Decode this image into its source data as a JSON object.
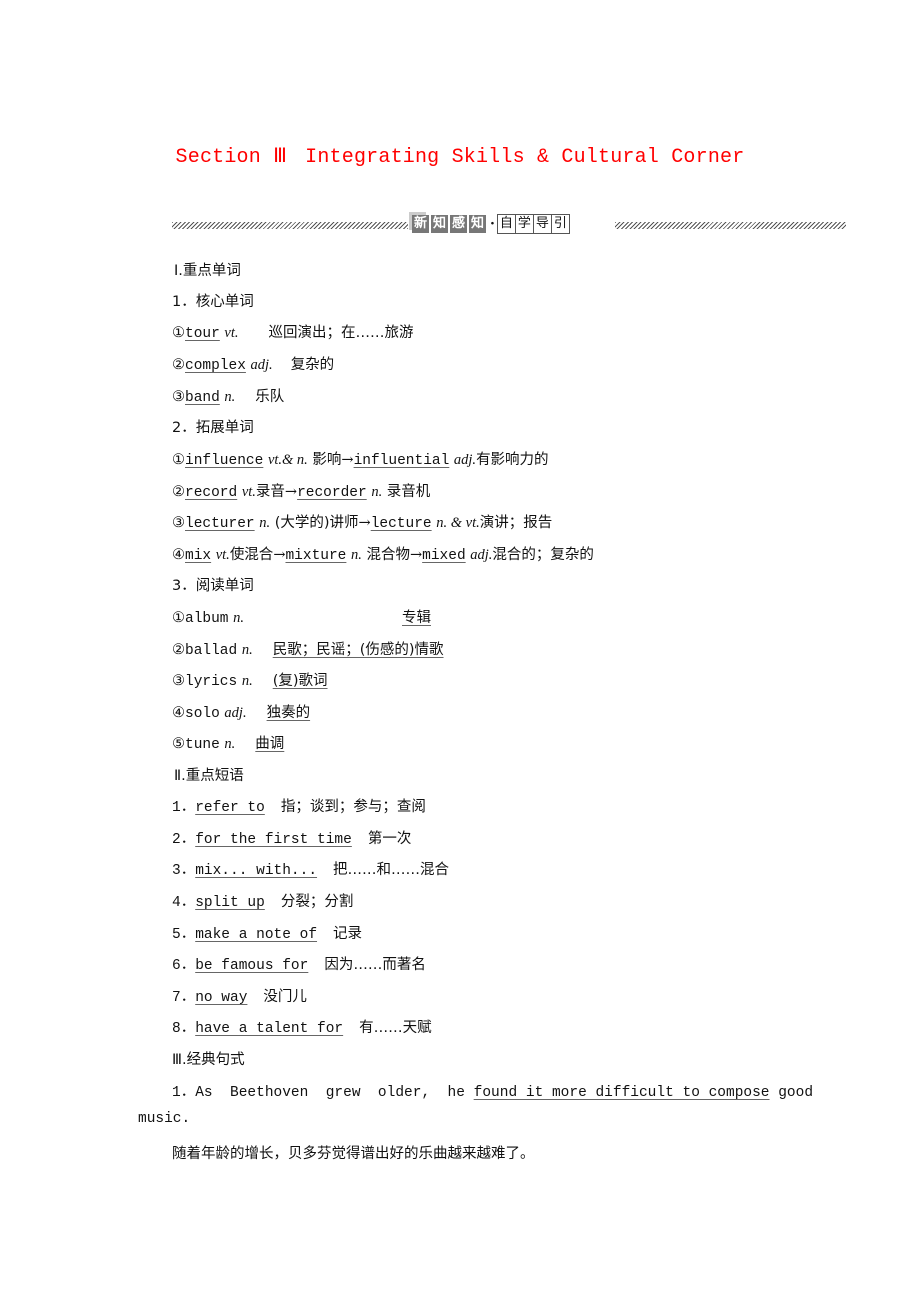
{
  "header": {
    "section": "Section Ⅲ",
    "title": "Integrating Skills & Cultural Corner",
    "title_color": "#ff0000"
  },
  "banner": {
    "dark_chars": [
      "新",
      "知",
      "感",
      "知"
    ],
    "separator": "·",
    "light_chars": [
      "自",
      "学",
      "导",
      "引"
    ]
  },
  "part1": {
    "heading": "Ⅰ.重点单词",
    "core": {
      "heading": "1．核心单词",
      "items": [
        {
          "num": "①",
          "word": "tour",
          "pos": "vt.",
          "meaning": "巡回演出；在……旅游"
        },
        {
          "num": "②",
          "word": "complex",
          "pos": "adj.",
          "meaning": "复杂的"
        },
        {
          "num": "③",
          "word": "band",
          "pos": "n.",
          "meaning": "乐队"
        }
      ]
    },
    "extended": {
      "heading": "2．拓展单词",
      "items": [
        {
          "num": "①",
          "word": "influence",
          "pos": "vt.& n.",
          "meaning": "影响",
          "arrow": "→",
          "word2": "influential",
          "pos2": "adj.",
          "meaning2": "有影响力的"
        },
        {
          "num": "②",
          "word": "record",
          "pos": "vt.",
          "meaning": "录音",
          "arrow": "→",
          "word2": "recorder",
          "pos2": "n.",
          "meaning2": "录音机"
        },
        {
          "num": "③",
          "word": "lecturer",
          "pos": "n.",
          "meaning": "(大学的)讲师",
          "arrow": "→",
          "word2": "lecture",
          "pos2": "n. & vt.",
          "meaning2": "演讲；报告"
        },
        {
          "num": "④",
          "word": "mix",
          "pos": "vt.",
          "meaning": "使混合",
          "arrow": "→",
          "word2": "mixture",
          "pos2": "n.",
          "meaning2": "混合物",
          "word3": "mixed",
          "pos3": "adj.",
          "meaning3": "混合的；复杂的"
        }
      ]
    },
    "reading": {
      "heading": "3．阅读单词",
      "items": [
        {
          "num": "①",
          "word": "album",
          "pos": "n.",
          "meaning": "专辑"
        },
        {
          "num": "②",
          "word": "ballad",
          "pos": "n.",
          "meaning": "民歌；民谣；(伤感的)情歌"
        },
        {
          "num": "③",
          "word": "lyrics",
          "pos": "n.",
          "meaning": "(复)歌词"
        },
        {
          "num": "④",
          "word": "solo",
          "pos": "adj.",
          "meaning": "独奏的"
        },
        {
          "num": "⑤",
          "word": "tune",
          "pos": "n.",
          "meaning": "曲调"
        }
      ]
    }
  },
  "part2": {
    "heading": "Ⅱ.重点短语",
    "items": [
      {
        "num": "1．",
        "phrase": "refer to",
        "meaning": "指；谈到；参与；查阅"
      },
      {
        "num": "2．",
        "phrase": "for the first time",
        "meaning": "第一次"
      },
      {
        "num": "3．",
        "phrase": "mix... with...",
        "meaning": "把……和……混合"
      },
      {
        "num": "4．",
        "phrase": "split up",
        "meaning": "分裂；分割"
      },
      {
        "num": "5．",
        "phrase": "make a note of",
        "meaning": "记录"
      },
      {
        "num": "6．",
        "phrase": "be famous for",
        "meaning": "因为……而著名"
      },
      {
        "num": "7．",
        "phrase": "no way",
        "meaning": "没门儿"
      },
      {
        "num": "8．",
        "phrase": "have a talent for",
        "meaning": "有……天赋"
      }
    ]
  },
  "part3": {
    "heading": "Ⅲ.经典句式",
    "sentence": {
      "num": "1．",
      "before": "As  Beethoven  grew  older,  he ",
      "underlined": "found it more difficult to compose",
      "after": " good",
      "continuation": "music.",
      "translation": "随着年龄的增长，贝多芬觉得谱出好的乐曲越来越难了。"
    }
  }
}
